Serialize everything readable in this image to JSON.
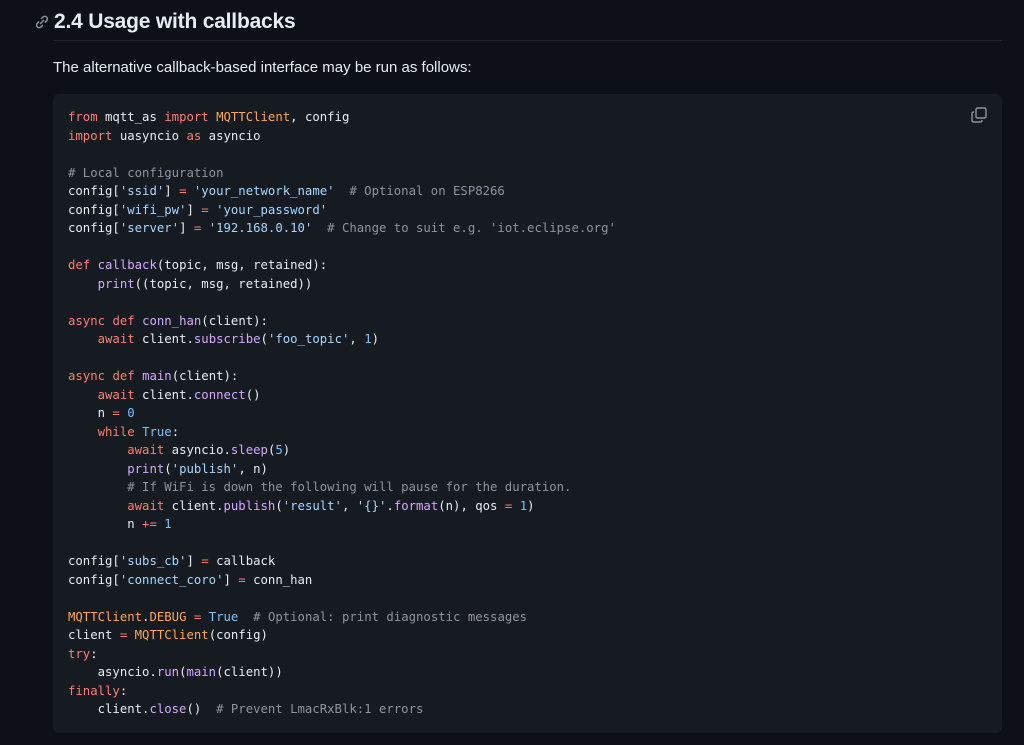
{
  "heading": {
    "icon": "link-icon",
    "title": "2.4 Usage with callbacks"
  },
  "intro": "The alternative callback-based interface may be run as follows:",
  "copy_icon": "copy-icon",
  "colors": {
    "background": "#0d1117",
    "code_background": "#161b22",
    "keyword": "#ff7b72",
    "function": "#d2a8ff",
    "string": "#a5d6ff",
    "number": "#79c0ff",
    "comment": "#8b949e",
    "class": "#ffa657",
    "text": "#e6edf3"
  },
  "code_lines": [
    [
      [
        "kw",
        "from"
      ],
      [
        "plain",
        " mqtt_as "
      ],
      [
        "kw",
        "import"
      ],
      [
        "plain",
        " "
      ],
      [
        "cls",
        "MQTTClient"
      ],
      [
        "plain",
        ", config"
      ]
    ],
    [
      [
        "kw",
        "import"
      ],
      [
        "plain",
        " uasyncio "
      ],
      [
        "kw",
        "as"
      ],
      [
        "plain",
        " asyncio"
      ]
    ],
    [],
    [
      [
        "com",
        "# Local configuration"
      ]
    ],
    [
      [
        "plain",
        "config["
      ],
      [
        "str",
        "'ssid'"
      ],
      [
        "plain",
        "] "
      ],
      [
        "kw",
        "="
      ],
      [
        "plain",
        " "
      ],
      [
        "str",
        "'your_network_name'"
      ],
      [
        "plain",
        "  "
      ],
      [
        "com",
        "# Optional on ESP8266"
      ]
    ],
    [
      [
        "plain",
        "config["
      ],
      [
        "str",
        "'wifi_pw'"
      ],
      [
        "plain",
        "] "
      ],
      [
        "kw",
        "="
      ],
      [
        "plain",
        " "
      ],
      [
        "str",
        "'your_password'"
      ]
    ],
    [
      [
        "plain",
        "config["
      ],
      [
        "str",
        "'server'"
      ],
      [
        "plain",
        "] "
      ],
      [
        "kw",
        "="
      ],
      [
        "plain",
        " "
      ],
      [
        "str",
        "'192.168.0.10'"
      ],
      [
        "plain",
        "  "
      ],
      [
        "com",
        "# Change to suit e.g. 'iot.eclipse.org'"
      ]
    ],
    [],
    [
      [
        "kw",
        "def"
      ],
      [
        "plain",
        " "
      ],
      [
        "fn",
        "callback"
      ],
      [
        "plain",
        "(topic, msg, retained):"
      ]
    ],
    [
      [
        "plain",
        "    "
      ],
      [
        "fn",
        "print"
      ],
      [
        "plain",
        "((topic, msg, retained))"
      ]
    ],
    [],
    [
      [
        "kw",
        "async"
      ],
      [
        "plain",
        " "
      ],
      [
        "kw",
        "def"
      ],
      [
        "plain",
        " "
      ],
      [
        "fn",
        "conn_han"
      ],
      [
        "plain",
        "(client):"
      ]
    ],
    [
      [
        "plain",
        "    "
      ],
      [
        "kw",
        "await"
      ],
      [
        "plain",
        " client."
      ],
      [
        "fn",
        "subscribe"
      ],
      [
        "plain",
        "("
      ],
      [
        "str",
        "'foo_topic'"
      ],
      [
        "plain",
        ", "
      ],
      [
        "num",
        "1"
      ],
      [
        "plain",
        ")"
      ]
    ],
    [],
    [
      [
        "kw",
        "async"
      ],
      [
        "plain",
        " "
      ],
      [
        "kw",
        "def"
      ],
      [
        "plain",
        " "
      ],
      [
        "fn",
        "main"
      ],
      [
        "plain",
        "(client):"
      ]
    ],
    [
      [
        "plain",
        "    "
      ],
      [
        "kw",
        "await"
      ],
      [
        "plain",
        " client."
      ],
      [
        "fn",
        "connect"
      ],
      [
        "plain",
        "()"
      ]
    ],
    [
      [
        "plain",
        "    n "
      ],
      [
        "kw",
        "="
      ],
      [
        "plain",
        " "
      ],
      [
        "num",
        "0"
      ]
    ],
    [
      [
        "plain",
        "    "
      ],
      [
        "kw",
        "while"
      ],
      [
        "plain",
        " "
      ],
      [
        "num",
        "True"
      ],
      [
        "plain",
        ":"
      ]
    ],
    [
      [
        "plain",
        "        "
      ],
      [
        "kw",
        "await"
      ],
      [
        "plain",
        " asyncio."
      ],
      [
        "fn",
        "sleep"
      ],
      [
        "plain",
        "("
      ],
      [
        "num",
        "5"
      ],
      [
        "plain",
        ")"
      ]
    ],
    [
      [
        "plain",
        "        "
      ],
      [
        "fn",
        "print"
      ],
      [
        "plain",
        "("
      ],
      [
        "str",
        "'publish'"
      ],
      [
        "plain",
        ", n)"
      ]
    ],
    [
      [
        "plain",
        "        "
      ],
      [
        "com",
        "# If WiFi is down the following will pause for the duration."
      ]
    ],
    [
      [
        "plain",
        "        "
      ],
      [
        "kw",
        "await"
      ],
      [
        "plain",
        " client."
      ],
      [
        "fn",
        "publish"
      ],
      [
        "plain",
        "("
      ],
      [
        "str",
        "'result'"
      ],
      [
        "plain",
        ", "
      ],
      [
        "str",
        "'{}'"
      ],
      [
        "plain",
        "."
      ],
      [
        "fn",
        "format"
      ],
      [
        "plain",
        "(n), qos "
      ],
      [
        "kw",
        "="
      ],
      [
        "plain",
        " "
      ],
      [
        "num",
        "1"
      ],
      [
        "plain",
        ")"
      ]
    ],
    [
      [
        "plain",
        "        n "
      ],
      [
        "kw",
        "+="
      ],
      [
        "plain",
        " "
      ],
      [
        "num",
        "1"
      ]
    ],
    [],
    [
      [
        "plain",
        "config["
      ],
      [
        "str",
        "'subs_cb'"
      ],
      [
        "plain",
        "] "
      ],
      [
        "kw",
        "="
      ],
      [
        "plain",
        " callback"
      ]
    ],
    [
      [
        "plain",
        "config["
      ],
      [
        "str",
        "'connect_coro'"
      ],
      [
        "plain",
        "] "
      ],
      [
        "kw",
        "="
      ],
      [
        "plain",
        " conn_han"
      ]
    ],
    [],
    [
      [
        "cls",
        "MQTTClient"
      ],
      [
        "plain",
        "."
      ],
      [
        "cls",
        "DEBUG"
      ],
      [
        "plain",
        " "
      ],
      [
        "kw",
        "="
      ],
      [
        "plain",
        " "
      ],
      [
        "num",
        "True"
      ],
      [
        "plain",
        "  "
      ],
      [
        "com",
        "# Optional: print diagnostic messages"
      ]
    ],
    [
      [
        "plain",
        "client "
      ],
      [
        "kw",
        "="
      ],
      [
        "plain",
        " "
      ],
      [
        "cls",
        "MQTTClient"
      ],
      [
        "plain",
        "(config)"
      ]
    ],
    [
      [
        "kw",
        "try"
      ],
      [
        "plain",
        ":"
      ]
    ],
    [
      [
        "plain",
        "    asyncio."
      ],
      [
        "fn",
        "run"
      ],
      [
        "plain",
        "("
      ],
      [
        "fn",
        "main"
      ],
      [
        "plain",
        "(client))"
      ]
    ],
    [
      [
        "kw",
        "finally"
      ],
      [
        "plain",
        ":"
      ]
    ],
    [
      [
        "plain",
        "    client."
      ],
      [
        "fn",
        "close"
      ],
      [
        "plain",
        "()  "
      ],
      [
        "com",
        "# Prevent LmacRxBlk:1 errors"
      ]
    ]
  ]
}
